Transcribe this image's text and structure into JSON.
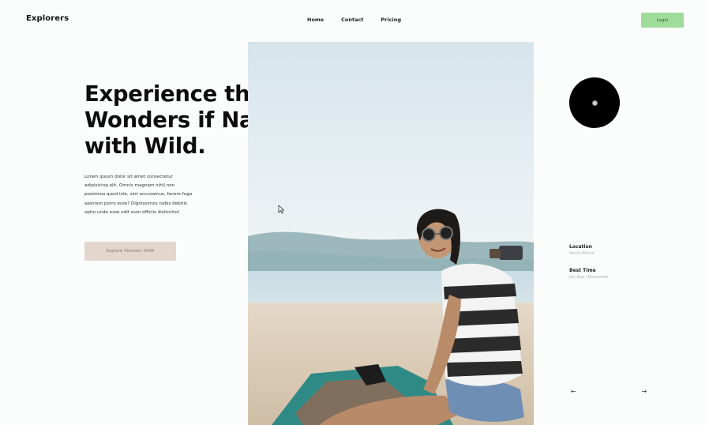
{
  "header": {
    "brand": "Explorers",
    "nav": [
      "Home",
      "Contact",
      "Pricing"
    ],
    "login_label": "Login"
  },
  "hero": {
    "headline": "Experience the Wonders if Nature with Wild.",
    "body": "Lorem ipsum dolor sit amet consectetur adipisicing elit. Omnis magnam nihil non possimus quod iste, sint accusamus, facere fuga aperiam porro esse? Dignissimos nobis debitis optio unde esse odit eum officiis distinctio!",
    "cta_label": "Explore Vietnam NOW"
  },
  "sidebar": {
    "location_label": "Location",
    "location_value": "Santa Wilton",
    "best_time_label": "Best Time",
    "best_time_value": "Jan-Sep / November"
  },
  "controls": {
    "prev_glyph": "←",
    "next_glyph": "→"
  },
  "colors": {
    "login_bg": "#9fdc9b",
    "cta_bg": "#e3d7cd",
    "disc": "#000000"
  },
  "icons": [
    "cursor-icon",
    "arrow-left-icon",
    "arrow-right-icon",
    "disc-icon"
  ]
}
